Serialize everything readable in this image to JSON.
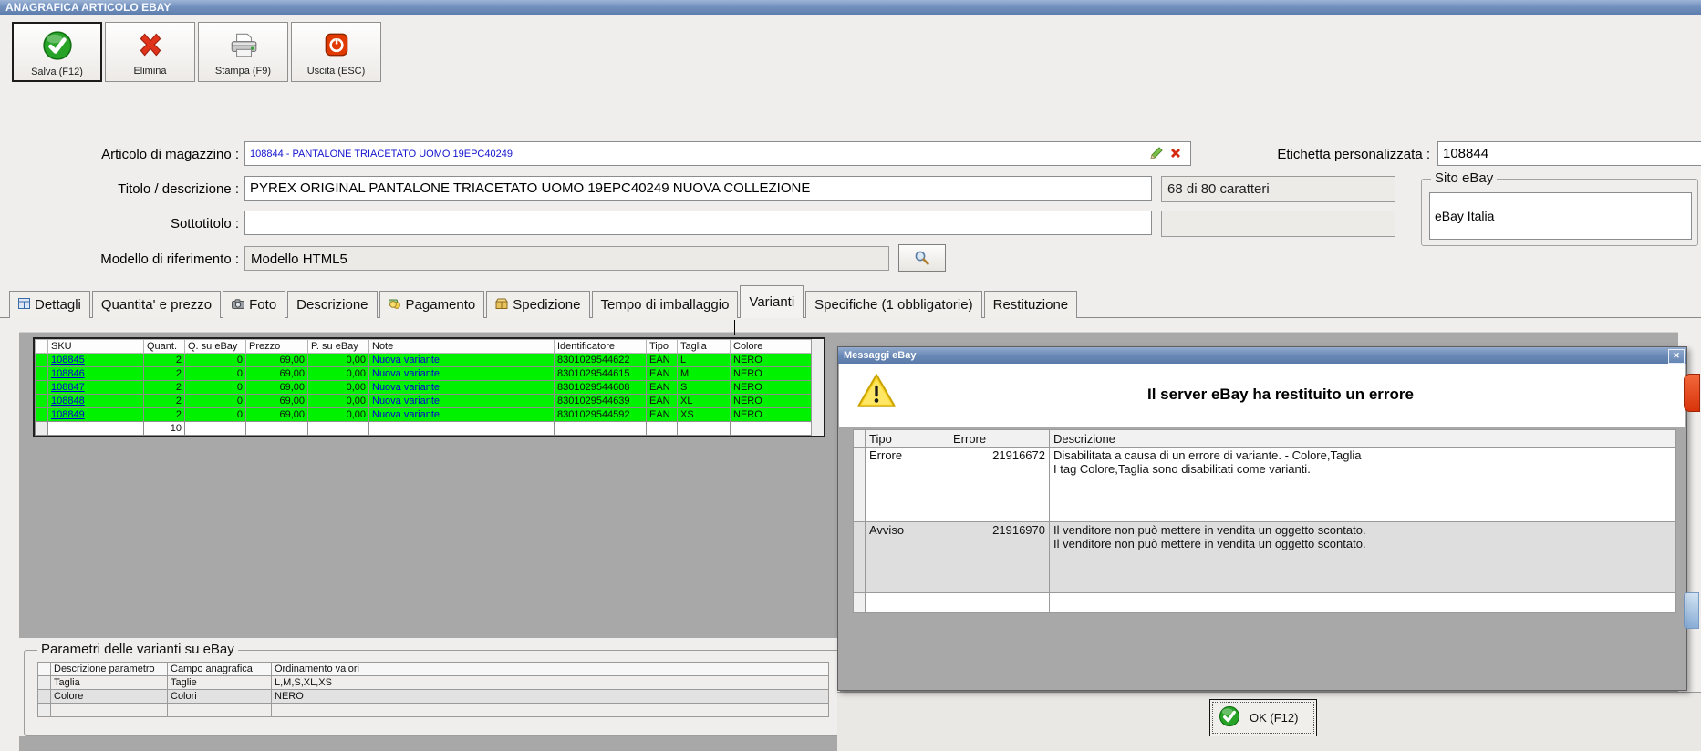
{
  "window": {
    "title": "ANAGRAFICA ARTICOLO EBAY"
  },
  "toolbar": {
    "save_label": "Salva (F12)",
    "delete_label": "Elimina",
    "print_label": "Stampa (F9)",
    "exit_label": "Uscita (ESC)"
  },
  "form": {
    "articolo_label": "Articolo di magazzino :",
    "articolo_value": "108844 - PANTALONE TRIACETATO UOMO 19EPC40249",
    "etichetta_label": "Etichetta personalizzata :",
    "etichetta_value": "108844",
    "titolo_label": "Titolo / descrizione :",
    "titolo_value": "PYREX ORIGINAL PANTALONE TRIACETATO UOMO 19EPC40249 NUOVA COLLEZIONE",
    "caratteri_counter": "68 di 80 caratteri",
    "sito_group_label": "Sito eBay",
    "sito_value": "eBay Italia",
    "sottotitolo_label": "Sottotitolo :",
    "sottotitolo_value": "",
    "modello_label": "Modello di riferimento :",
    "modello_value": "Modello HTML5"
  },
  "tabs": [
    {
      "label": "Dettagli"
    },
    {
      "label": "Quantita' e prezzo"
    },
    {
      "label": "Foto"
    },
    {
      "label": "Descrizione"
    },
    {
      "label": "Pagamento"
    },
    {
      "label": "Spedizione"
    },
    {
      "label": "Tempo di imballaggio"
    },
    {
      "label": "Varianti",
      "active": true
    },
    {
      "label": "Specifiche (1 obbligatorie)"
    },
    {
      "label": "Restituzione"
    }
  ],
  "variants_table": {
    "headers": {
      "sku": "SKU",
      "quant": "Quant.",
      "qebay": "Q. su eBay",
      "prezzo": "Prezzo",
      "pebay": "P. su eBay",
      "note": "Note",
      "ident": "Identificatore",
      "tipo": "Tipo",
      "taglia": "Taglia",
      "colore": "Colore"
    },
    "rows": [
      {
        "sku": "108845",
        "quant": "2",
        "qebay": "0",
        "prezzo": "69,00",
        "pebay": "0,00",
        "note": "Nuova variante",
        "ident": "8301029544622",
        "tipo": "EAN",
        "taglia": "L",
        "colore": "NERO"
      },
      {
        "sku": "108846",
        "quant": "2",
        "qebay": "0",
        "prezzo": "69,00",
        "pebay": "0,00",
        "note": "Nuova variante",
        "ident": "8301029544615",
        "tipo": "EAN",
        "taglia": "M",
        "colore": "NERO"
      },
      {
        "sku": "108847",
        "quant": "2",
        "qebay": "0",
        "prezzo": "69,00",
        "pebay": "0,00",
        "note": "Nuova variante",
        "ident": "8301029544608",
        "tipo": "EAN",
        "taglia": "S",
        "colore": "NERO"
      },
      {
        "sku": "108848",
        "quant": "2",
        "qebay": "0",
        "prezzo": "69,00",
        "pebay": "0,00",
        "note": "Nuova variante",
        "ident": "8301029544639",
        "tipo": "EAN",
        "taglia": "XL",
        "colore": "NERO"
      },
      {
        "sku": "108849",
        "quant": "2",
        "qebay": "0",
        "prezzo": "69,00",
        "pebay": "0,00",
        "note": "Nuova variante",
        "ident": "8301029544592",
        "tipo": "EAN",
        "taglia": "XS",
        "colore": "NERO"
      }
    ],
    "total_quant": "10"
  },
  "dialog": {
    "title": "Messaggi eBay",
    "close_glyph": "✕",
    "heading": "Il server eBay ha restituito un errore",
    "table": {
      "headers": {
        "tipo": "Tipo",
        "errore": "Errore",
        "descrizione": "Descrizione"
      },
      "rows": [
        {
          "tipo": "Errore",
          "codice": "21916672",
          "line1": "Disabilitata a causa di un errore di variante. - Colore,Taglia",
          "line2": "I tag Colore,Taglia sono disabilitati come varianti."
        },
        {
          "tipo": "Avviso",
          "codice": "21916970",
          "line1": "Il venditore non può mettere in vendita un oggetto scontato.",
          "line2": "Il venditore non può mettere in vendita un oggetto scontato."
        }
      ]
    },
    "ok_label": "OK (F12)"
  },
  "parametri": {
    "group_label": "Parametri delle varianti su eBay",
    "headers": {
      "descrizione": "Descrizione parametro",
      "campo": "Campo anagrafica",
      "ordinamento": "Ordinamento valori"
    },
    "rows": [
      {
        "descrizione": "Taglia",
        "campo": "Taglie",
        "ordinamento": "L,M,S,XL,XS"
      },
      {
        "descrizione": "Colore",
        "campo": "Colori",
        "ordinamento": "NERO"
      }
    ]
  },
  "colors": {
    "variant_row_green": "#00f200",
    "link_blue": "#0000d8",
    "titlebar_blue": "#7290bd",
    "warning_yellow": "#ffd92e",
    "panel_gray": "#a8a8a8"
  }
}
